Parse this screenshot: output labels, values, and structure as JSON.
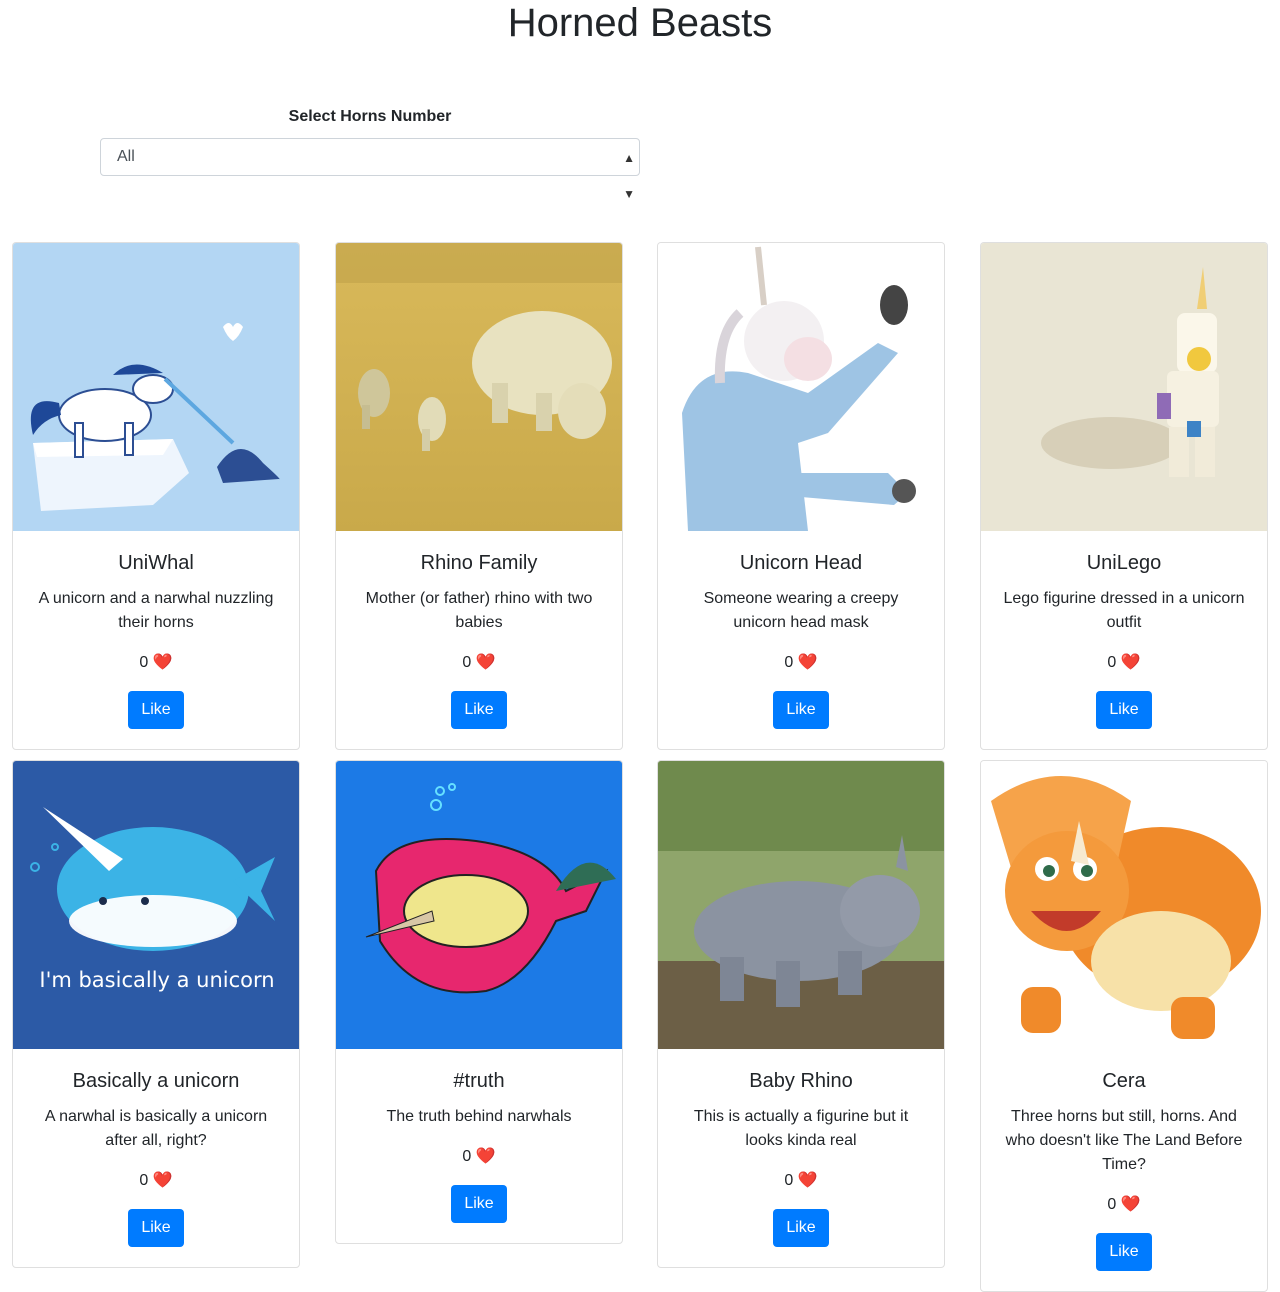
{
  "page": {
    "title": "Horned Beasts"
  },
  "filter": {
    "label": "Select Horns Number",
    "selected": "All"
  },
  "heart_glyph": "❤️",
  "colors": {
    "button": "#007bff",
    "heart": "#dc1e25"
  },
  "cards": [
    {
      "title": "UniWhal",
      "description": "A unicorn and a narwhal nuzzling their horns",
      "likes": "0",
      "button_label": "Like",
      "image": "unicorn-and-narwhal-illustration"
    },
    {
      "title": "Rhino Family",
      "description": "Mother (or father) rhino with two babies",
      "likes": "0",
      "button_label": "Like",
      "image": "rhino-family-photo"
    },
    {
      "title": "Unicorn Head",
      "description": "Someone wearing a creepy unicorn head mask",
      "likes": "0",
      "button_label": "Like",
      "image": "unicorn-mask-photo"
    },
    {
      "title": "UniLego",
      "description": "Lego figurine dressed in a unicorn outfit",
      "likes": "0",
      "button_label": "Like",
      "image": "lego-unicorn-photo"
    },
    {
      "title": "Basically a unicorn",
      "description": "A narwhal is basically a unicorn after all, right?",
      "likes": "0",
      "button_label": "Like",
      "image": "narwhal-illustration",
      "image_caption": "I'm basically a unicorn"
    },
    {
      "title": "#truth",
      "description": "The truth behind narwhals",
      "likes": "0",
      "button_label": "Like",
      "image": "narwhal-inside-illustration"
    },
    {
      "title": "Baby Rhino",
      "description": "This is actually a figurine but it looks kinda real",
      "likes": "0",
      "button_label": "Like",
      "image": "baby-rhino-photo"
    },
    {
      "title": "Cera",
      "description": "Three horns but still, horns. And who doesn't like The Land Before Time?",
      "likes": "0",
      "button_label": "Like",
      "image": "triceratops-cartoon"
    }
  ]
}
